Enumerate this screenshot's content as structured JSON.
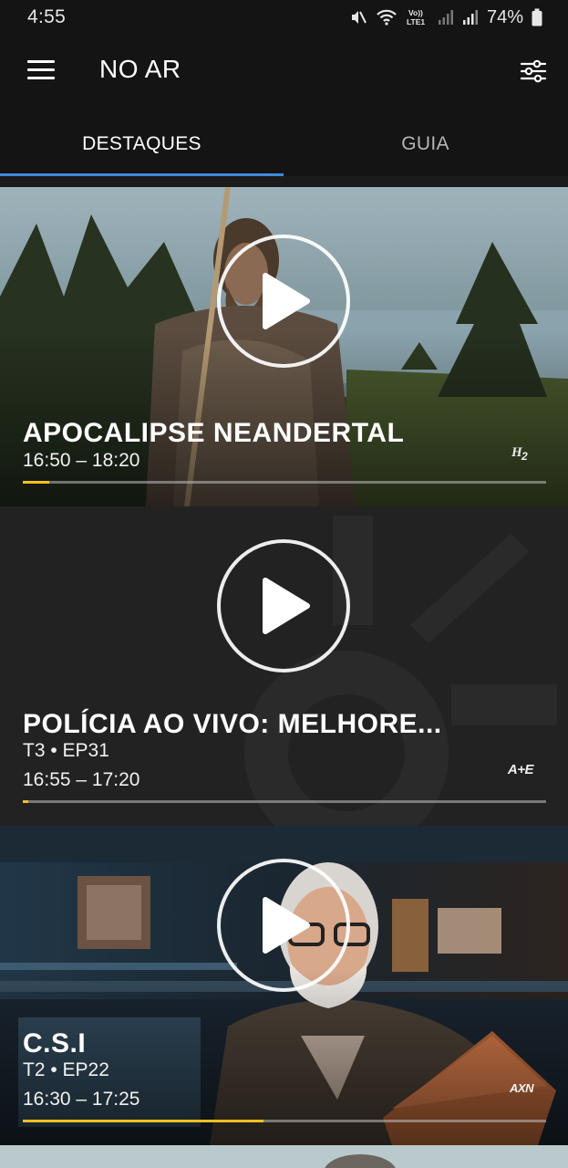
{
  "status_bar": {
    "time": "4:55",
    "battery": "74%",
    "icons": [
      "mute-icon",
      "wifi-icon",
      "volte-icon",
      "signal-icon",
      "signal-icon",
      "battery-icon"
    ],
    "volte_label": "Vo)) LTE1"
  },
  "app_bar": {
    "title": "NO AR",
    "menu_icon": "hamburger-menu-icon",
    "filter_icon": "filter-sliders-icon"
  },
  "tabs": [
    {
      "label": "DESTAQUES",
      "active": true
    },
    {
      "label": "GUIA",
      "active": false
    }
  ],
  "colors": {
    "tab_indicator": "#3d8bdc",
    "progress_fill": "#f4c022",
    "background": "#141414"
  },
  "cards": [
    {
      "title": "APOCALIPSE NEANDERTAL",
      "episode": "",
      "time": "16:50 – 18:20",
      "channel": "H2",
      "progress": 0.05
    },
    {
      "title": "POLÍCIA AO VIVO: MELHORE...",
      "episode": "T3 • EP31",
      "time": "16:55 – 17:20",
      "channel": "A+E",
      "progress": 0.01
    },
    {
      "title": "C.S.I",
      "episode": "T2 • EP22",
      "time": "16:30 – 17:25",
      "channel": "AXN",
      "progress": 0.46
    }
  ]
}
